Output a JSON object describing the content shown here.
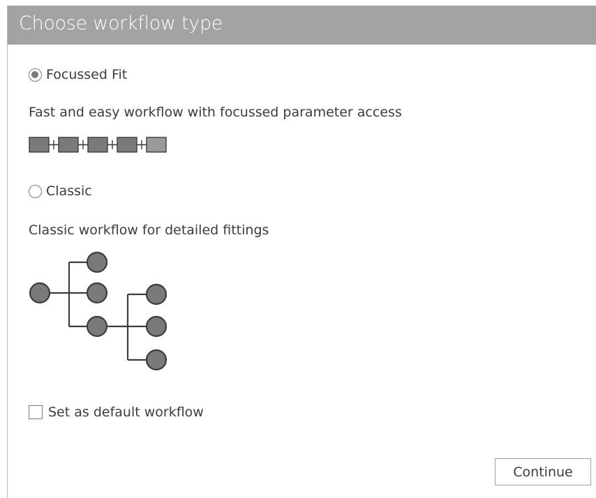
{
  "dialog": {
    "title": "Choose workflow type"
  },
  "options": [
    {
      "label": "Focussed Fit",
      "description": "Fast and easy workflow with focussed parameter access",
      "selected": true,
      "icon": "linear-workflow-icon"
    },
    {
      "label": "Classic",
      "description": "Classic workflow for detailed fittings",
      "selected": false,
      "icon": "tree-workflow-icon"
    }
  ],
  "default_checkbox": {
    "label": "Set as default workflow",
    "checked": false
  },
  "footer": {
    "continue_label": "Continue"
  },
  "colors": {
    "title_bar": "#a3a3a3",
    "icon_fill": "#7a7a7a",
    "icon_fill_light": "#9a9a9a",
    "icon_stroke": "#3c3c3c"
  }
}
